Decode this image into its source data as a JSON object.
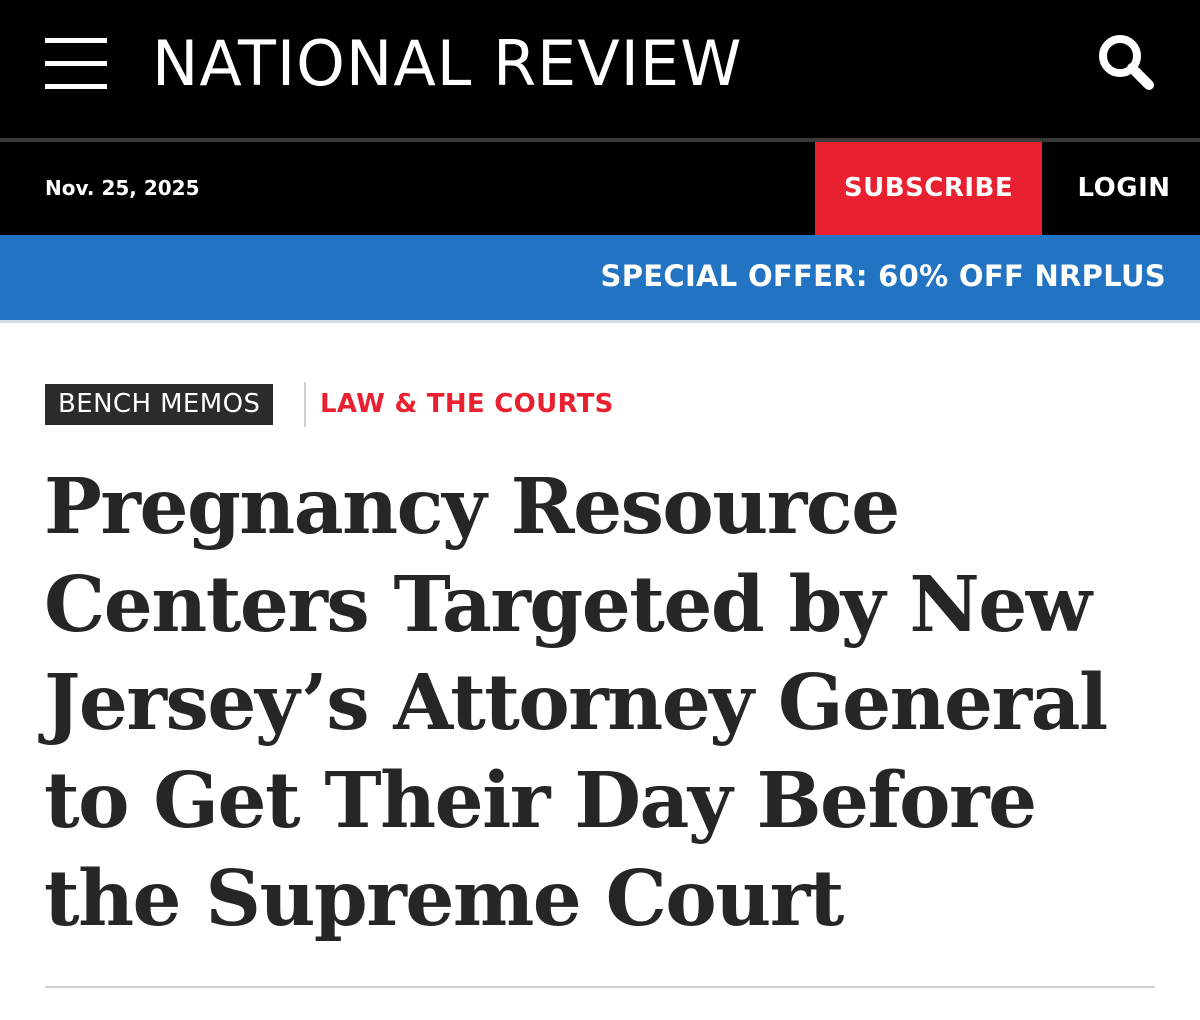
{
  "header": {
    "brand": "NATIONAL REVIEW",
    "menu_icon": "hamburger-menu-icon",
    "search_icon": "search-icon",
    "background": "#000000"
  },
  "subbar": {
    "date": "Nov. 25, 2025",
    "subscribe_label": "SUBSCRIBE",
    "login_label": "LOGIN",
    "subscribe_color": "#e8202f"
  },
  "offer": {
    "text": "SPECIAL OFFER: 60% OFF NRPLUS",
    "background": "#2274c3"
  },
  "article": {
    "section": "BENCH MEMOS",
    "category": "LAW & THE COURTS",
    "headline": "Pregnancy Resource Centers Targeted by New Jersey’s Attorney General to Get Their Day Before the Supreme Court"
  }
}
